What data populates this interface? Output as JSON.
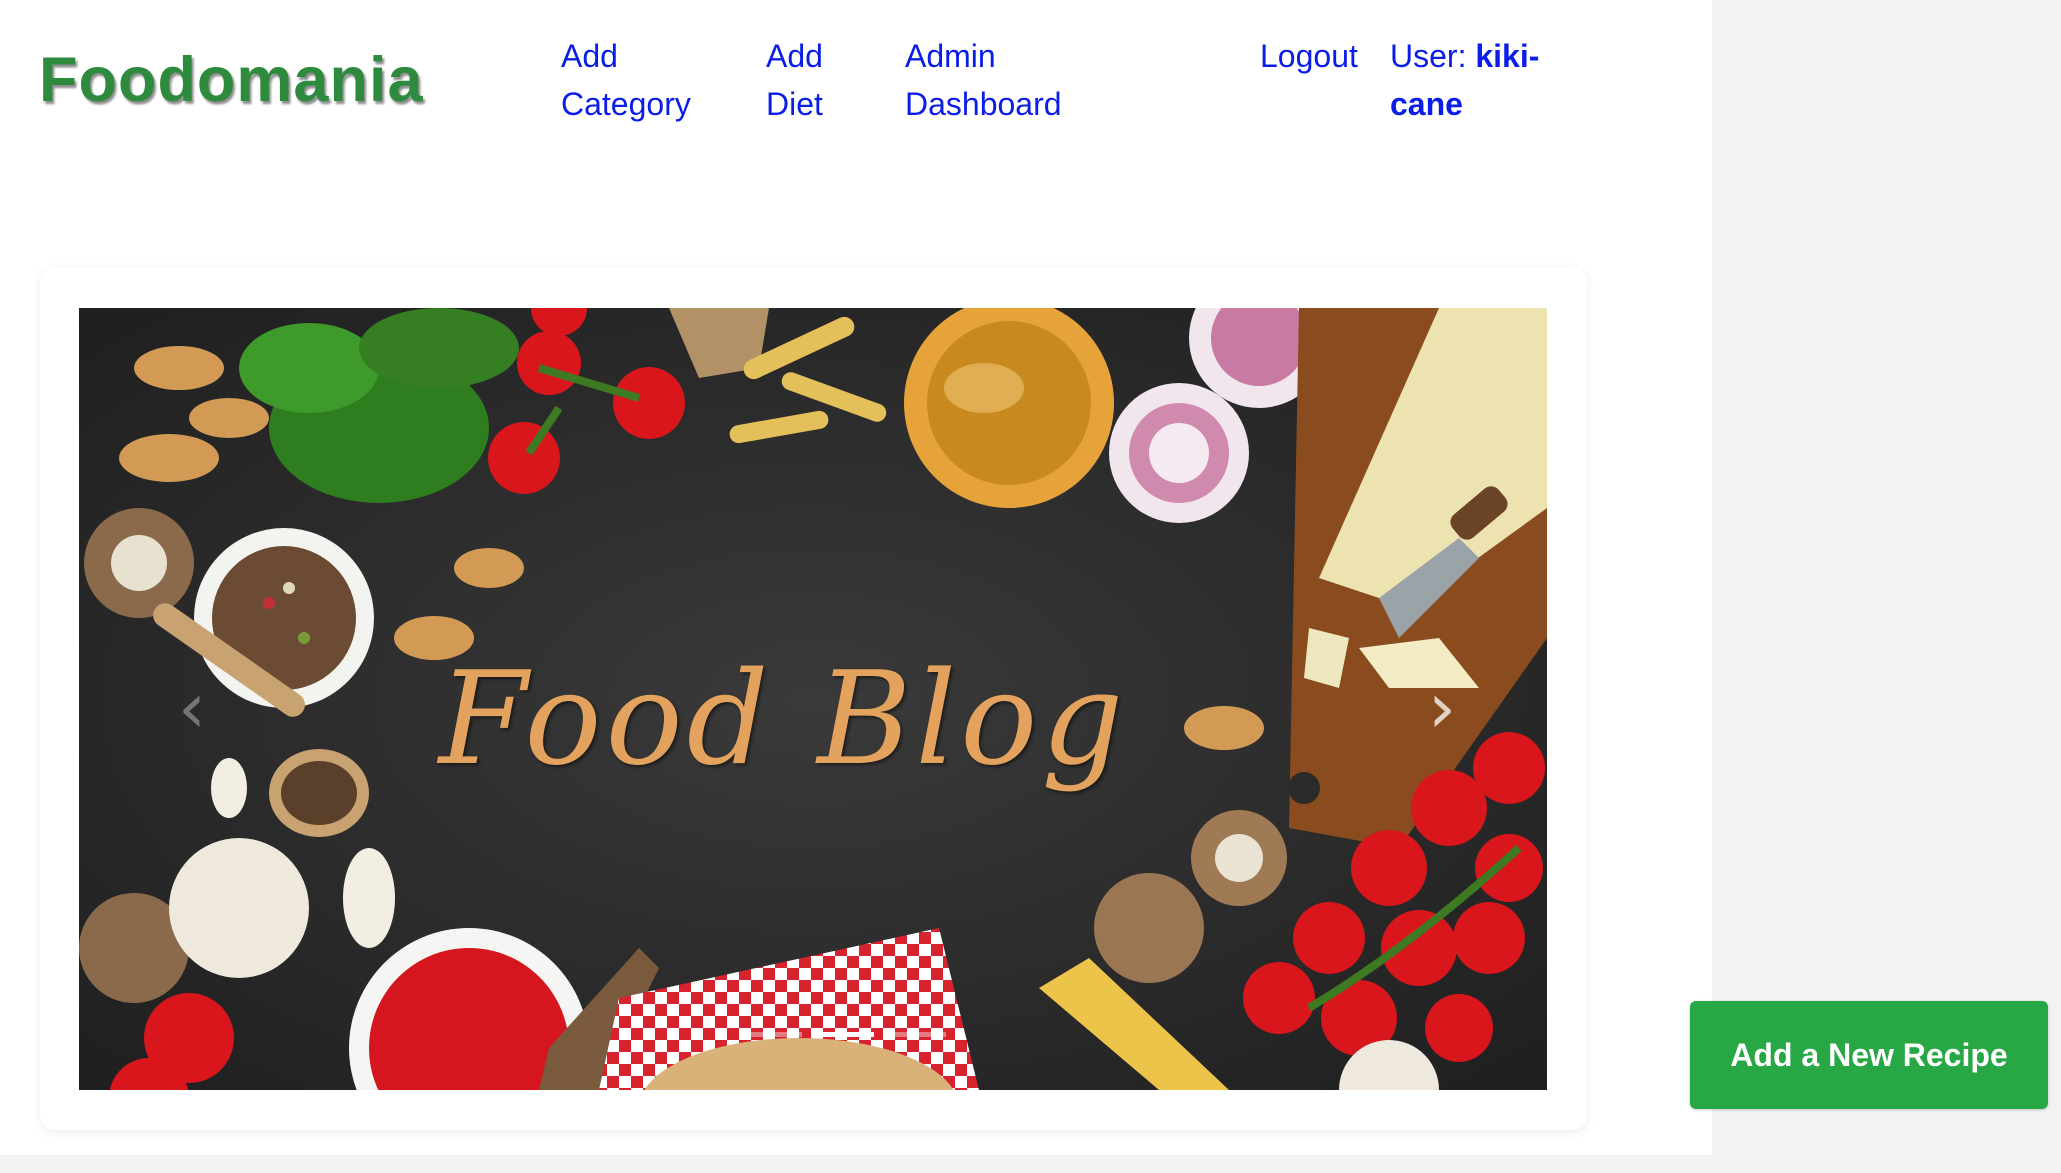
{
  "header": {
    "logo": "Foodomania",
    "nav": [
      {
        "line1": "Add",
        "line2": "Category"
      },
      {
        "line1": "Add",
        "line2": "Diet"
      },
      {
        "line1": "Admin",
        "line2": "Dashboard"
      }
    ],
    "logout": "Logout",
    "user_prefix": "User: ",
    "user_name_1": "kiki-",
    "user_name_2": "cane"
  },
  "carousel": {
    "caption": "Food Blog",
    "prev_icon": "chevron-left-icon",
    "next_icon": "chevron-right-icon",
    "slide_count": 3,
    "active_slide": 2
  },
  "actions": {
    "add_recipe": "Add a New Recipe"
  },
  "colors": {
    "logo": "#2e8b3e",
    "link": "#0a1ee8",
    "button": "#28a745",
    "board": "#2b2b2b"
  }
}
